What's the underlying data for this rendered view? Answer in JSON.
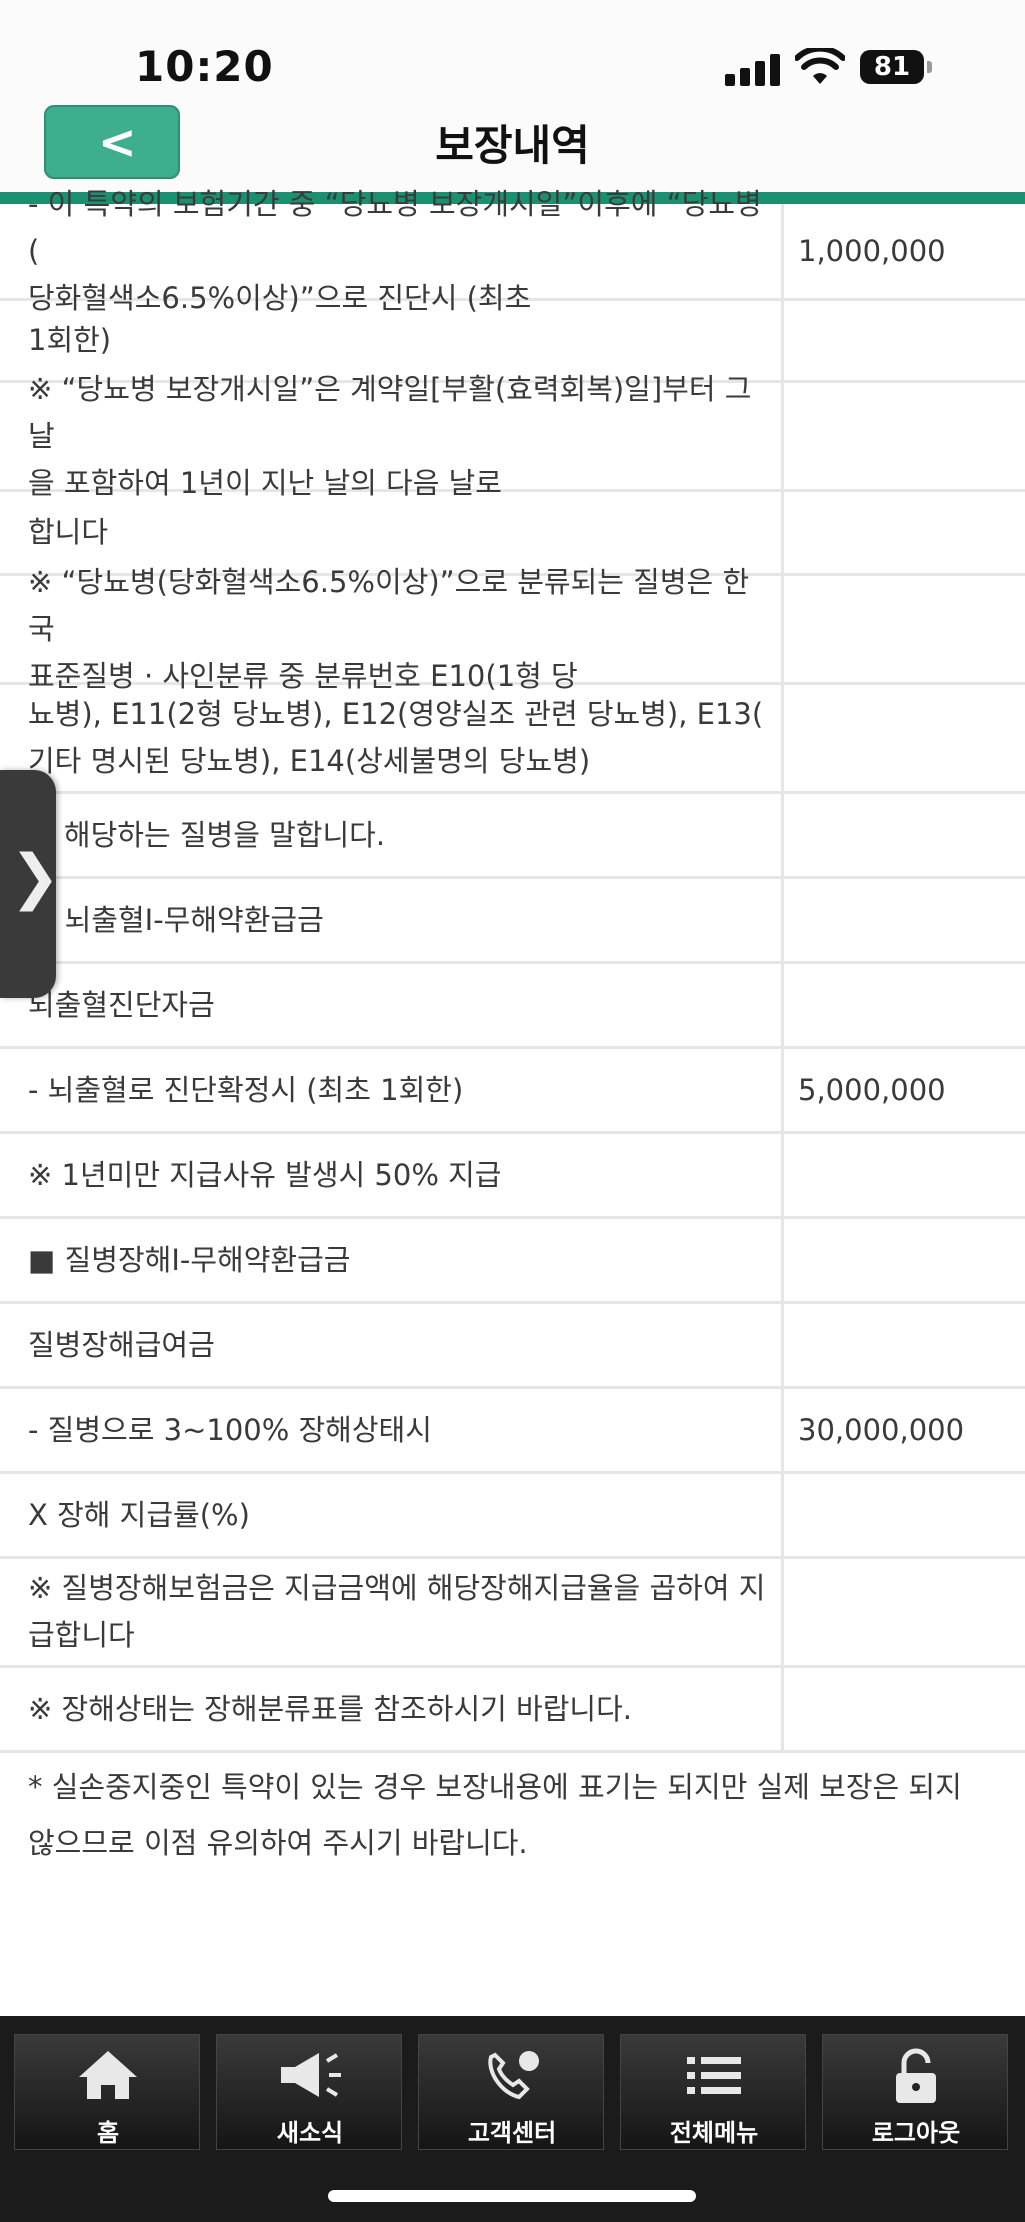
{
  "status": {
    "time": "10:20",
    "battery": "81"
  },
  "header": {
    "title": "보장내역",
    "back_label": "<"
  },
  "rows": [
    {
      "h": 94,
      "lines": [
        "- 이 특약의 보험기간 중 “당뇨병 보장개시일”이후에 “당뇨병(",
        "당화혈색소6.5%이상)”으로 진단시 (최초"
      ],
      "amount": "1,000,000"
    },
    {
      "h": 79,
      "lines": [
        "1회한)"
      ],
      "amount": ""
    },
    {
      "h": 106,
      "lines": [
        "※ “당뇨병 보장개시일”은 계약일[부활(효력회복)일]부터 그 날",
        "을 포함하여 1년이 지난 날의 다음 날로"
      ],
      "amount": ""
    },
    {
      "h": 81,
      "lines": [
        "합니다"
      ],
      "amount": ""
    },
    {
      "h": 106,
      "lines": [
        "※ “당뇨병(당화혈색소6.5%이상)”으로 분류되는 질병은 한국",
        "표준질병 · 사인분류 중 분류번호 E10(1형 당"
      ],
      "amount": ""
    },
    {
      "h": 106,
      "lines": [
        "뇨병), E11(2형 당뇨병), E12(영양실조 관련 당뇨병), E13(",
        "기타 명시된 당뇨병), E14(상세불명의 당뇨병)"
      ],
      "amount": ""
    },
    {
      "h": 82,
      "lines": [
        "에 해당하는 질병을 말합니다."
      ],
      "amount": ""
    },
    {
      "h": 82,
      "lines": [
        "■ 뇌출혈I-무해약환급금"
      ],
      "amount": ""
    },
    {
      "h": 82,
      "lines": [
        "뇌출혈진단자금"
      ],
      "amount": ""
    },
    {
      "h": 82,
      "lines": [
        "- 뇌출혈로 진단확정시 (최초 1회한)"
      ],
      "amount": "5,000,000"
    },
    {
      "h": 82,
      "lines": [
        "※ 1년미만 지급사유 발생시 50% 지급"
      ],
      "amount": ""
    },
    {
      "h": 82,
      "lines": [
        "■ 질병장해I-무해약환급금"
      ],
      "amount": ""
    },
    {
      "h": 82,
      "lines": [
        "질병장해급여금"
      ],
      "amount": ""
    },
    {
      "h": 82,
      "lines": [
        "- 질병으로 3~100% 장해상태시"
      ],
      "amount": "30,000,000"
    },
    {
      "h": 82,
      "lines": [
        "X 장해 지급률(%)"
      ],
      "amount": ""
    },
    {
      "h": 106,
      "lines": [
        "※ 질병장해보험금은 지급금액에 해당장해지급율을 곱하여 지",
        "급합니다"
      ],
      "amount": ""
    },
    {
      "h": 82,
      "lines": [
        "※ 장해상태는 장해분류표를 참조하시기 바랍니다."
      ],
      "amount": ""
    }
  ],
  "footnote": "* 실손중지중인 특약이 있는 경우 보장내용에 표기는 되지만 실제 보장은 되지 않으므로 이점 유의하여 주시기 바랍니다.",
  "nav": [
    {
      "label": "홈",
      "icon": "home-icon"
    },
    {
      "label": "새소식",
      "icon": "megaphone-icon"
    },
    {
      "label": "고객센터",
      "icon": "phone-icon"
    },
    {
      "label": "전체메뉴",
      "icon": "menu-icon"
    },
    {
      "label": "로그아웃",
      "icon": "lock-icon"
    }
  ],
  "colors": {
    "accent": "#1a9070",
    "back_button": "#3fae8e",
    "nav_bg": "#1b1b1b"
  }
}
